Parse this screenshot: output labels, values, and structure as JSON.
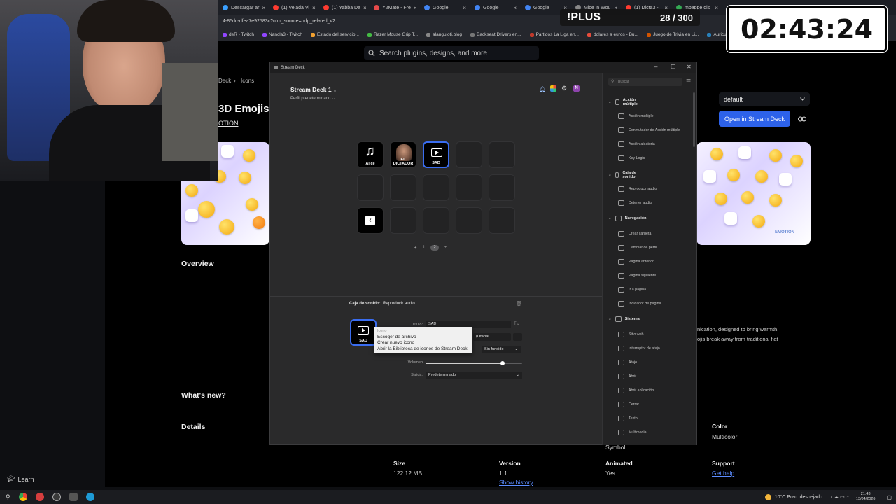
{
  "browser": {
    "tabs": [
      {
        "label": "Descargar ar",
        "color": "#3aa0ff"
      },
      {
        "label": "(1) Velada Vi",
        "color": "#ff3b30"
      },
      {
        "label": "(1) Yabba Da",
        "color": "#ff3b30"
      },
      {
        "label": "Y2Mate - Fre",
        "color": "#e64a4a"
      },
      {
        "label": "Google",
        "color": "#4285f4"
      },
      {
        "label": "Google",
        "color": "#4285f4"
      },
      {
        "label": "Google",
        "color": "#4285f4"
      },
      {
        "label": "Mice in Wou",
        "color": "#888888"
      },
      {
        "label": "(1) Dicta3 -",
        "color": "#ff3b30"
      },
      {
        "label": "mbappe dis",
        "color": "#34a853"
      }
    ],
    "url": "4-85dc-dfea7e92583c?utm_source=pdp_related_v2",
    "bookmarks": [
      "deR - Twitch",
      "Nancla3 - Twitch",
      "Estado del servicio...",
      "Razer Mouse Grip T...",
      "alanguloti.blog",
      "Backseat Drivers en...",
      "Partidos La Liga en...",
      "dolares a euros - Bu...",
      "Juego de Trivia en Li...",
      "Auriculares Philips I..."
    ]
  },
  "site": {
    "search_placeholder": "Search plugins, designs, and more",
    "breadcrumb": [
      "Deck",
      "Icons"
    ],
    "title": "3D Emojis",
    "author": "OTION",
    "profile_select": "default",
    "open_button": "Open in Stream Deck",
    "overview": "Overview",
    "description_line1": "nication, designed to bring warmth,",
    "description_line2": "ojis break away from traditional flat",
    "whats_new": "What's new?",
    "details": "Details",
    "meta": {
      "size_label": "Size",
      "size_value": "122.12 MB",
      "version_label": "Version",
      "version_value": "1.1",
      "version_link": "Show history",
      "animated_label": "Animated",
      "animated_value": "Yes",
      "support_label": "Support",
      "support_link": "Get help",
      "color_label": "Color",
      "color_value": "Multicolor",
      "symbol_label": "Symbol"
    },
    "thumb_watermark": "EMOTION"
  },
  "streamdeck": {
    "window_title": "Stream Deck",
    "device_name": "Stream Deck 1",
    "profile_name": "Perfil predeterminado",
    "keys": [
      {
        "label": "Alice",
        "type": "music",
        "selected": false
      },
      {
        "label": "EL DICTADOR",
        "type": "photo",
        "selected": false
      },
      {
        "label": "SAD",
        "type": "sound",
        "selected": true
      }
    ],
    "pager": [
      "1",
      "2"
    ],
    "action_category": "Caja de sonido:",
    "action_name": "Reproducir audio",
    "editor_icon_label": "SAD",
    "fields": {
      "title_label": "Título:",
      "title_value": "SAD",
      "file_value": "(Official",
      "fade_value": "Sin fundido",
      "volume_label": "Volumen",
      "volume_percent": 80,
      "output_label": "Salida:",
      "output_value": "Predeterminado"
    },
    "menu": {
      "header": "Icono",
      "items": [
        "Escoger de archivo",
        "Crear nuevo icono",
        "Abrir la Biblioteca de iconos de Stream Deck"
      ]
    },
    "side": {
      "search_placeholder": "Buscar",
      "categories": [
        {
          "name": "Acción múltiple",
          "items": [
            "Acción múltiple",
            "Conmutador de Acción múltiple",
            "Acción aleatoria",
            "Key Logic"
          ]
        },
        {
          "name": "Caja de sonido",
          "items": [
            "Reproducir audio",
            "Detener audio"
          ]
        },
        {
          "name": "Navegación",
          "items": [
            "Crear carpeta",
            "Cambiar de perfil",
            "Página anterior",
            "Página siguiente",
            "Ir a página",
            "Indicador de página"
          ]
        },
        {
          "name": "Sistema",
          "items": [
            "Sitio web",
            "Interruptor de atajo",
            "Atajo",
            "Abrir",
            "Abrir aplicación",
            "Cerrar",
            "Texto",
            "Multimedia"
          ]
        }
      ]
    }
  },
  "overlay": {
    "timer": "02:43:24",
    "plus_label": "!PLUS",
    "plus_count": "28 / 300"
  },
  "taskbar": {
    "learn": "Learn",
    "weather": "10°C  Prac. despejado",
    "time": "21:43",
    "date": "13/04/2026"
  }
}
